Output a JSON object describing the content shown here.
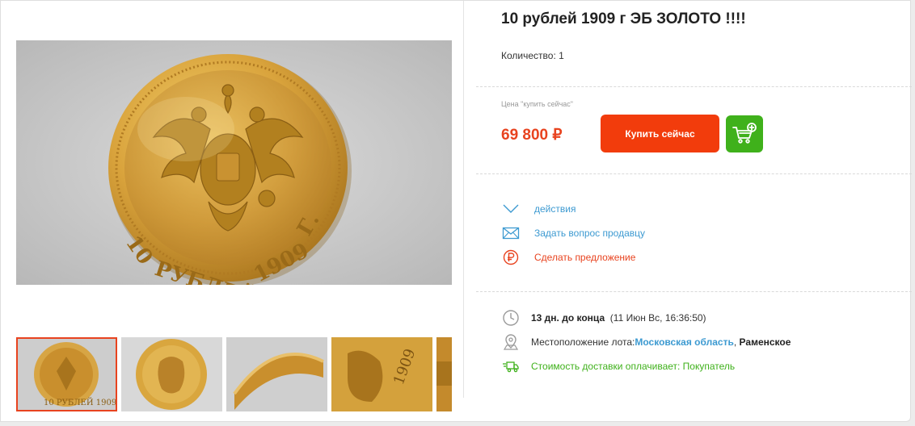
{
  "lot": {
    "title": "10 рублей 1909 г ЭБ ЗОЛОТО !!!!",
    "quantity_label": "Количество: 1"
  },
  "price": {
    "label": "Цена \"купить сейчас\"",
    "value": "69 800",
    "currency": "₽",
    "buy_label": "Купить сейчас"
  },
  "actions": [
    {
      "label": "действия",
      "icon": "chevron-down-icon",
      "color": "#3d9ad1"
    },
    {
      "label": "Задать вопрос продавцу",
      "icon": "envelope-icon",
      "color": "#3d9ad1"
    },
    {
      "label": "Сделать предложение",
      "icon": "ruble-circle-icon",
      "color": "#e8431f"
    }
  ],
  "meta": {
    "time_bold": "13 дн. до конца",
    "time_rest": "(11 Июн Вс, 16:36:50)",
    "location_label": "Местоположение лота:",
    "location_region": "Московская область",
    "location_sep": ",",
    "location_city": "Раменское",
    "delivery": "Стоимость доставки оплачивает: Покупатель"
  },
  "gallery": {
    "selected_index": 0,
    "thumb_count": 5
  },
  "colors": {
    "accent": "#f23c0c",
    "price": "#e8431f",
    "link": "#3d9ad1",
    "cart": "#3fb11b",
    "gold": "#c9962e"
  }
}
